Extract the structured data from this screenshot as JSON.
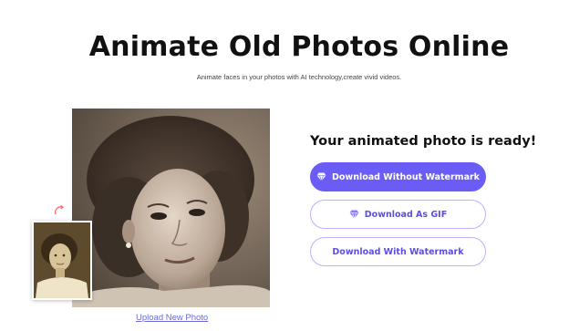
{
  "header": {
    "title": "Animate Old Photos Online",
    "subtitle": "Animate faces in your photos with AI technology,create vivid videos."
  },
  "result": {
    "ready_text": "Your animated photo is ready!",
    "buttons": {
      "download_no_watermark": "Download Without Watermark",
      "download_gif": "Download As GIF",
      "download_watermark": "Download With Watermark"
    }
  },
  "upload": {
    "link_label": "Upload New Photo"
  },
  "icons": {
    "premium": "diamond-icon",
    "reload": "refresh-icon"
  },
  "colors": {
    "accent": "#6b5cf6",
    "link": "#6b6bd8"
  }
}
